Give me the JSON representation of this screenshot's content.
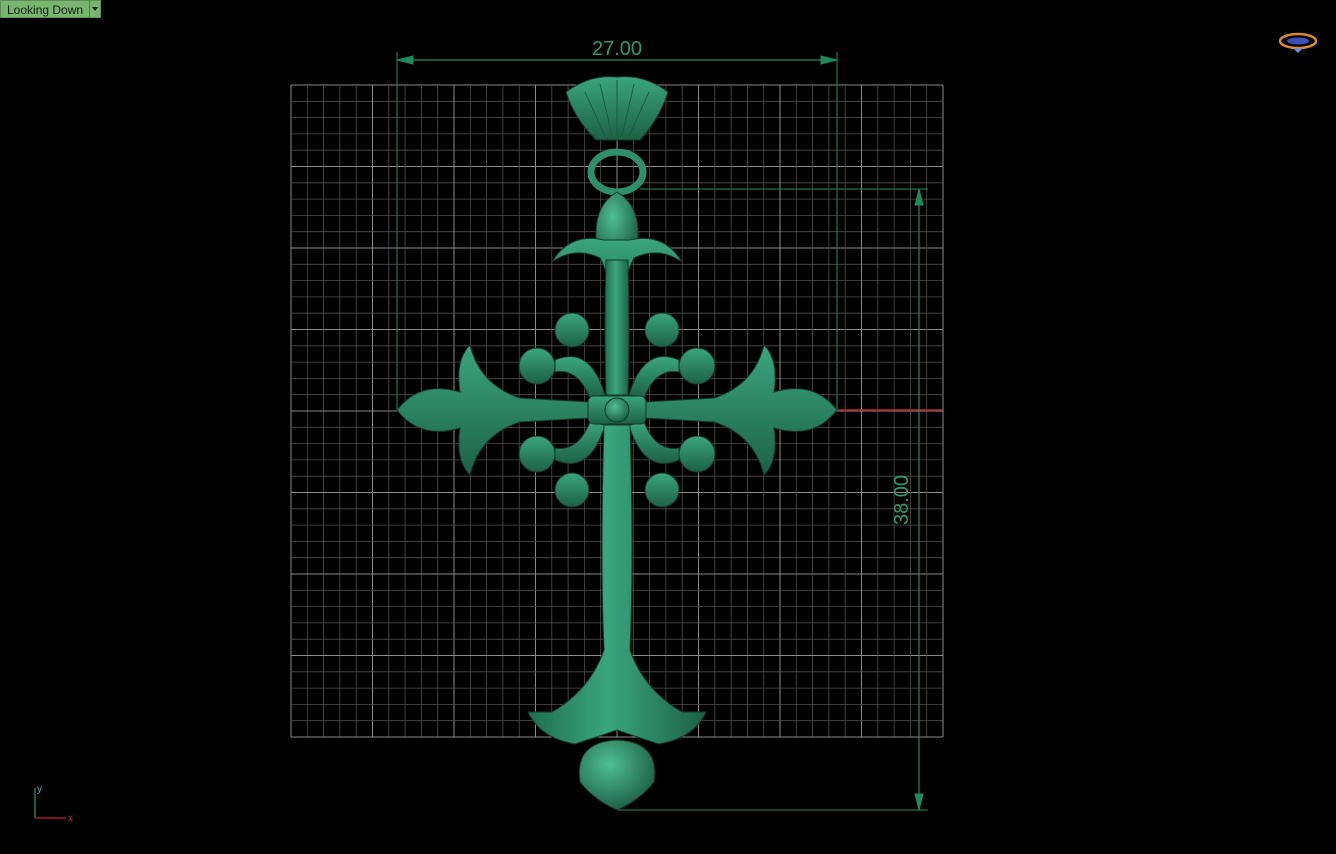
{
  "viewport": {
    "view_name": "Looking Down",
    "dimensions": {
      "width_label": "27.00",
      "height_label": "38.00"
    },
    "axes": {
      "x_label": "x",
      "y_label": "y"
    },
    "colors": {
      "background": "#000000",
      "grid_minor": "#5a5a5a",
      "grid_major": "#8a8a8a",
      "model": "#2e8f6c",
      "dimension": "#1f8a5c",
      "x_axis": "#c0201c",
      "y_axis": "#2a8a3a",
      "view_tab": "#78b56f"
    }
  },
  "icons": {
    "view_dropdown": "chevron-down-icon",
    "logo": "gem-ring-logo-icon",
    "axes": "axis-triad-icon"
  }
}
